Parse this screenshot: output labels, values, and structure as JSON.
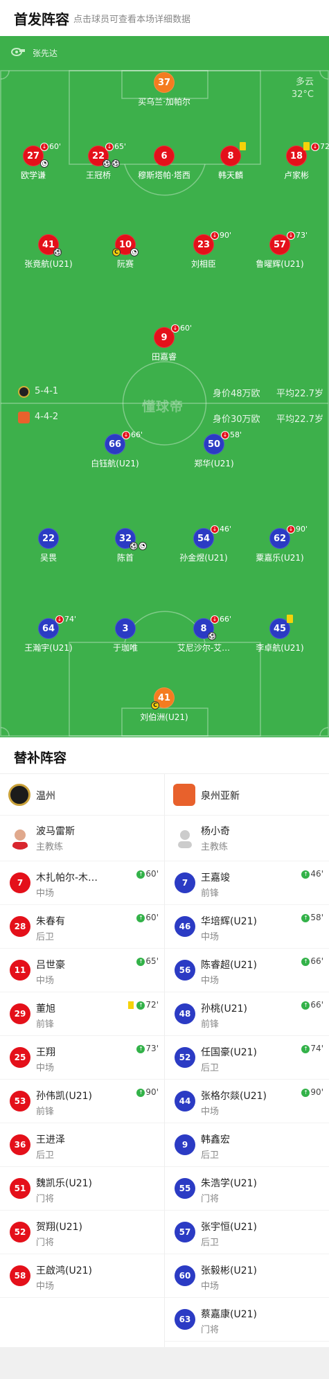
{
  "header": {
    "title": "首发阵容",
    "subtitle": "点击球员可查看本场详细数据"
  },
  "referee": "张先达",
  "weather": {
    "condition": "多云",
    "temperature": "32°C"
  },
  "watermark": "懂球帝",
  "home_team": {
    "name": "温州",
    "formation": "5-4-1",
    "value": "身价48万欧",
    "avg_age": "平均22.7岁",
    "goalkeeper": {
      "number": "37",
      "name": "买乌兰·加帕尔"
    },
    "players": [
      {
        "number": "27",
        "name": "欧学谦",
        "sub_time": "60'"
      },
      {
        "number": "22",
        "name": "王冠桥",
        "sub_time": "65'"
      },
      {
        "number": "6",
        "name": "穆斯塔帕·塔西"
      },
      {
        "number": "8",
        "name": "韩天麟"
      },
      {
        "number": "18",
        "name": "卢家彬",
        "sub_time": "72'"
      },
      {
        "number": "41",
        "name": "张竟航(U21)"
      },
      {
        "number": "10",
        "name": "阮赛"
      },
      {
        "number": "23",
        "name": "刘相臣",
        "sub_time": "90'"
      },
      {
        "number": "57",
        "name": "鲁曜辉(U21)",
        "sub_time": "73'"
      },
      {
        "number": "9",
        "name": "田嘉睿",
        "sub_time": "60'"
      }
    ]
  },
  "away_team": {
    "name": "泉州亚新",
    "formation": "4-4-2",
    "value": "身价30万欧",
    "avg_age": "平均22.7岁",
    "goalkeeper": {
      "number": "41",
      "name": "刘伯洲(U21)"
    },
    "players": [
      {
        "number": "66",
        "name": "白钰航(U21)",
        "sub_time": "66'"
      },
      {
        "number": "50",
        "name": "郑华(U21)",
        "sub_time": "58'"
      },
      {
        "number": "22",
        "name": "吴畏"
      },
      {
        "number": "32",
        "name": "陈首"
      },
      {
        "number": "54",
        "name": "孙金煜(U21)",
        "sub_time": "46'"
      },
      {
        "number": "62",
        "name": "粟嘉乐(U21)",
        "sub_time": "90'"
      },
      {
        "number": "64",
        "name": "王瀚宇(U21)",
        "sub_time": "74'"
      },
      {
        "number": "3",
        "name": "于珈唯"
      },
      {
        "number": "8",
        "name": "艾尼沙尔-艾…",
        "sub_time": "66'"
      },
      {
        "number": "45",
        "name": "李卓航(U21)"
      }
    ]
  },
  "substitutes": {
    "title": "替补阵容",
    "home": {
      "team_name": "温州",
      "coach": {
        "name": "波马雷斯",
        "role": "主教练"
      },
      "players": [
        {
          "number": "7",
          "name": "木扎帕尔-木…",
          "position": "中场",
          "time": "60'"
        },
        {
          "number": "28",
          "name": "朱春有",
          "position": "后卫",
          "time": "60'"
        },
        {
          "number": "11",
          "name": "吕世豪",
          "position": "中场",
          "time": "65'"
        },
        {
          "number": "29",
          "name": "董旭",
          "position": "前锋",
          "time": "72'"
        },
        {
          "number": "25",
          "name": "王翔",
          "position": "中场",
          "time": "73'"
        },
        {
          "number": "53",
          "name": "孙伟凯(U21)",
          "position": "前锋",
          "time": "90'"
        },
        {
          "number": "36",
          "name": "王进泽",
          "position": "后卫"
        },
        {
          "number": "51",
          "name": "魏凯乐(U21)",
          "position": "门将"
        },
        {
          "number": "52",
          "name": "贺翔(U21)",
          "position": "门将"
        },
        {
          "number": "58",
          "name": "王啟鸿(U21)",
          "position": "中场"
        }
      ]
    },
    "away": {
      "team_name": "泉州亚新",
      "coach": {
        "name": "杨小奇",
        "role": "主教练"
      },
      "players": [
        {
          "number": "7",
          "name": "王嘉竣",
          "position": "前锋",
          "time": "46'"
        },
        {
          "number": "46",
          "name": "华培辉(U21)",
          "position": "中场",
          "time": "58'"
        },
        {
          "number": "56",
          "name": "陈睿超(U21)",
          "position": "中场",
          "time": "66'"
        },
        {
          "number": "48",
          "name": "孙桃(U21)",
          "position": "前锋",
          "time": "66'"
        },
        {
          "number": "52",
          "name": "任国豪(U21)",
          "position": "后卫",
          "time": "74'"
        },
        {
          "number": "44",
          "name": "张格尔燚(U21)",
          "position": "中场",
          "time": "90'"
        },
        {
          "number": "9",
          "name": "韩鑫宏",
          "position": "后卫"
        },
        {
          "number": "55",
          "name": "朱浩学(U21)",
          "position": "门将"
        },
        {
          "number": "57",
          "name": "张宇恒(U21)",
          "position": "后卫"
        },
        {
          "number": "60",
          "name": "张毅彬(U21)",
          "position": "中场"
        },
        {
          "number": "63",
          "name": "蔡嘉康(U21)",
          "position": "门将"
        }
      ]
    }
  },
  "colors": {
    "pitch": "#3db04b",
    "home": "#e4101a",
    "away": "#2b3bc4",
    "keeper": "#f47c20",
    "sub_in": "#33b249",
    "yellow_card": "#f5d20a"
  }
}
